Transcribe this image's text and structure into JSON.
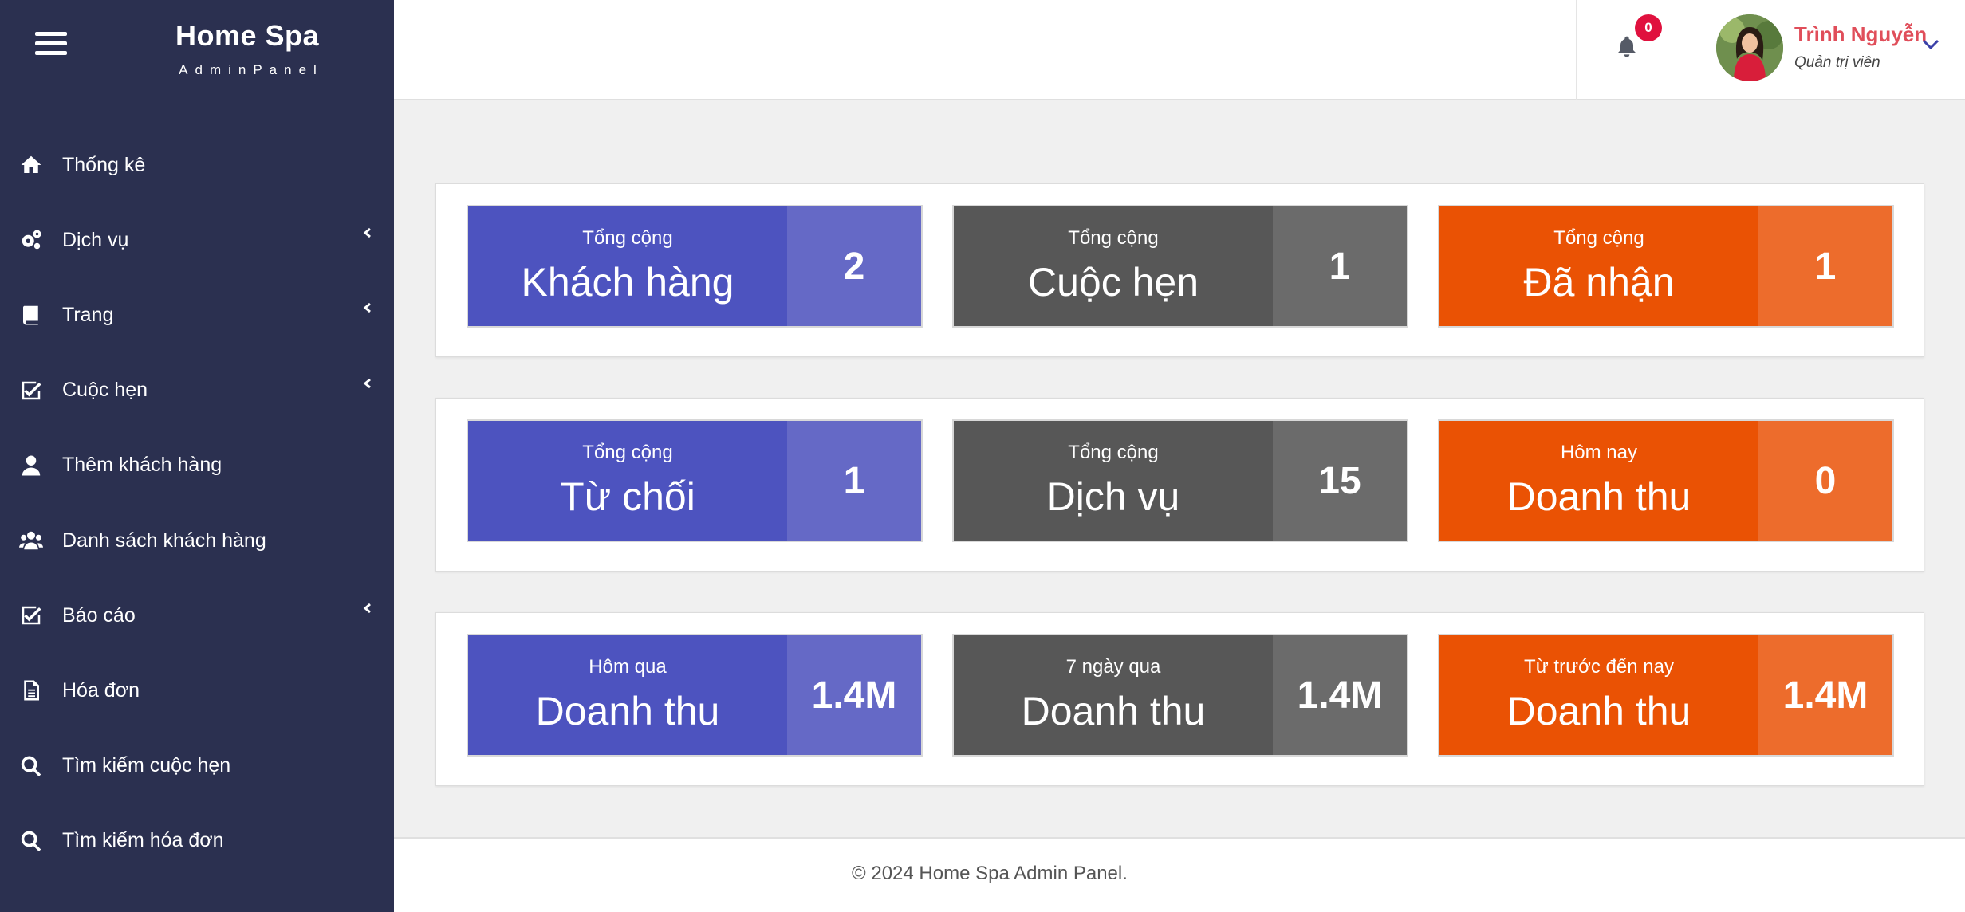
{
  "brand": {
    "title": "Home Spa",
    "subtitle": "AdminPanel"
  },
  "sidebar": {
    "items": [
      {
        "label": "Thống kê",
        "icon": "home-icon",
        "has_submenu": false
      },
      {
        "label": "Dịch vụ",
        "icon": "gears-icon",
        "has_submenu": true
      },
      {
        "label": "Trang",
        "icon": "book-icon",
        "has_submenu": true
      },
      {
        "label": "Cuộc hẹn",
        "icon": "check-square-icon",
        "has_submenu": true
      },
      {
        "label": "Thêm khách hàng",
        "icon": "user-icon",
        "has_submenu": false
      },
      {
        "label": "Danh sách khách hàng",
        "icon": "users-icon",
        "has_submenu": false
      },
      {
        "label": "Báo cáo",
        "icon": "check-square-icon",
        "has_submenu": true
      },
      {
        "label": "Hóa đơn",
        "icon": "file-icon",
        "has_submenu": false
      },
      {
        "label": "Tìm kiếm cuộc hẹn",
        "icon": "search-icon",
        "has_submenu": false
      },
      {
        "label": "Tìm kiếm hóa đơn",
        "icon": "search-icon",
        "has_submenu": false
      }
    ]
  },
  "header": {
    "notifications_count": "0",
    "user": {
      "name": "Trình Nguyễn",
      "role": "Quản trị viên"
    }
  },
  "stats": [
    [
      {
        "small": "Tổng cộng",
        "big": "Khách hàng",
        "value": "2",
        "color": "blue"
      },
      {
        "small": "Tổng cộng",
        "big": "Cuộc hẹn",
        "value": "1",
        "color": "gray"
      },
      {
        "small": "Tổng cộng",
        "big": "Đã nhận",
        "value": "1",
        "color": "orange"
      }
    ],
    [
      {
        "small": "Tổng cộng",
        "big": "Từ chối",
        "value": "1",
        "color": "blue"
      },
      {
        "small": "Tổng cộng",
        "big": "Dịch vụ",
        "value": "15",
        "color": "gray"
      },
      {
        "small": "Hôm nay",
        "big": "Doanh thu",
        "value": "0",
        "color": "orange"
      }
    ],
    [
      {
        "small": "Hôm qua",
        "big": "Doanh thu",
        "value": "1.4M",
        "color": "blue"
      },
      {
        "small": "7 ngày qua",
        "big": "Doanh thu",
        "value": "1.4M",
        "color": "gray"
      },
      {
        "small": "Từ trước đến nay",
        "big": "Doanh thu",
        "value": "1.4M",
        "color": "orange"
      }
    ]
  ],
  "colors": {
    "sidebar_bg": "#2b3050",
    "blue": "#4d53bf",
    "gray": "#575757",
    "orange": "#ea5204",
    "badge": "#e0113e",
    "user_name": "#e04e5a"
  },
  "footer": {
    "text": "© 2024 Home Spa Admin Panel."
  }
}
